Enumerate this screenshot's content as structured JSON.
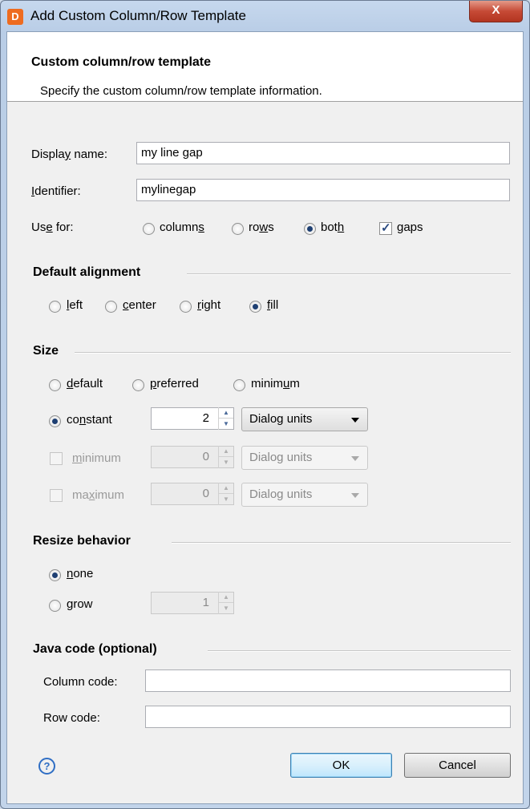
{
  "window": {
    "title": "Add Custom Column/Row Template",
    "close_glyph": "X",
    "app_icon_letter": "D"
  },
  "banner": {
    "title": "Custom column/row template",
    "description": "Specify the custom column/row template information."
  },
  "form": {
    "display_name": {
      "label_pre": "Displa",
      "label_mn": "y",
      "label_post": " name:",
      "value": "my line gap"
    },
    "identifier": {
      "label_pre": "",
      "label_mn": "I",
      "label_post": "dentifier:",
      "value": "mylinegap"
    },
    "use_for": {
      "label_pre": "Us",
      "label_mn": "e",
      "label_post": " for:",
      "columns": {
        "pre": "column",
        "mn": "s",
        "post": ""
      },
      "rows": {
        "pre": "ro",
        "mn": "w",
        "post": "s"
      },
      "both": {
        "pre": "bot",
        "mn": "h",
        "post": ""
      },
      "gaps": {
        "pre": "",
        "mn": "g",
        "post": "aps"
      },
      "selected": "both",
      "gaps_checked": true
    }
  },
  "alignment": {
    "heading": "Default alignment",
    "left": {
      "pre": "",
      "mn": "l",
      "post": "eft"
    },
    "center": {
      "pre": "",
      "mn": "c",
      "post": "enter"
    },
    "right": {
      "pre": "",
      "mn": "r",
      "post": "ight"
    },
    "fill": {
      "pre": "",
      "mn": "f",
      "post": "ill"
    },
    "selected": "fill"
  },
  "size": {
    "heading": "Size",
    "default": {
      "pre": "",
      "mn": "d",
      "post": "efault"
    },
    "preferred": {
      "pre": "",
      "mn": "p",
      "post": "referred"
    },
    "minimum": {
      "pre": "minim",
      "mn": "u",
      "post": "m"
    },
    "constant": {
      "pre": "co",
      "mn": "n",
      "post": "stant",
      "value": "2",
      "unit": "Dialog units"
    },
    "min_check": {
      "pre": "",
      "mn": "m",
      "post": "inimum",
      "value": "0",
      "unit": "Dialog units",
      "checked": false
    },
    "max_check": {
      "pre": "ma",
      "mn": "x",
      "post": "imum",
      "value": "0",
      "unit": "Dialog units",
      "checked": false
    },
    "selected": "constant"
  },
  "resize": {
    "heading": "Resize behavior",
    "none": {
      "pre": "",
      "mn": "n",
      "post": "one"
    },
    "grow": {
      "pre": "",
      "mn": "g",
      "post": "row",
      "value": "1"
    },
    "selected": "none"
  },
  "java": {
    "heading": "Java code (optional)",
    "column_code_label": "Column code:",
    "row_code_label": "Row code:",
    "column_code_value": "",
    "row_code_value": ""
  },
  "buttons": {
    "help": "?",
    "ok": "OK",
    "cancel": "Cancel"
  },
  "colors": {
    "accent": "#2f6ec4",
    "close_red": "#c64a36",
    "app_icon": "#ee6b1f"
  }
}
